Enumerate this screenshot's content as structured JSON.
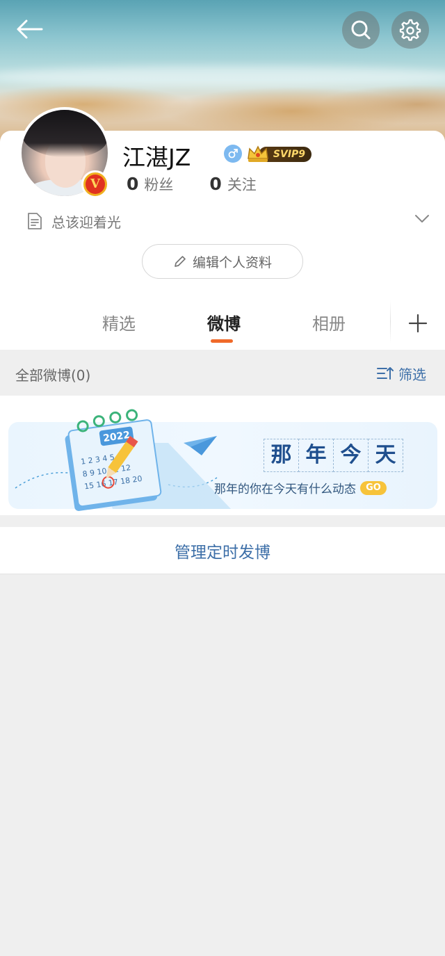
{
  "profile": {
    "username": "江湛JZ",
    "badge_level": "SVIP9",
    "fans_count": "0",
    "fans_label": "粉丝",
    "following_count": "0",
    "following_label": "关注",
    "bio": "总该迎着光",
    "edit_label": "编辑个人资料",
    "verified_mark": "V"
  },
  "tabs": [
    {
      "label": "精选",
      "active": false
    },
    {
      "label": "微博",
      "active": true
    },
    {
      "label": "相册",
      "active": false
    }
  ],
  "feed": {
    "count_label": "全部微博(0)",
    "filter_label": "筛选"
  },
  "memory_banner": {
    "title_chars": [
      "那",
      "年",
      "今",
      "天"
    ],
    "subtitle": "那年的你在今天有什么动态",
    "go_label": "GO",
    "calendar_year": "2022"
  },
  "schedule": {
    "label": "管理定时发博"
  },
  "colors": {
    "accent_orange": "#f06a2a",
    "link_blue": "#3d6fa8",
    "page_bg": "#efefef"
  },
  "icons": {
    "back": "arrow-left-icon",
    "search": "search-icon",
    "settings": "gear-icon",
    "gender": "male-icon",
    "bio": "document-icon",
    "expand": "chevron-down-icon",
    "edit": "pencil-icon",
    "add_tab": "plus-icon",
    "filter": "sort-filter-icon"
  }
}
